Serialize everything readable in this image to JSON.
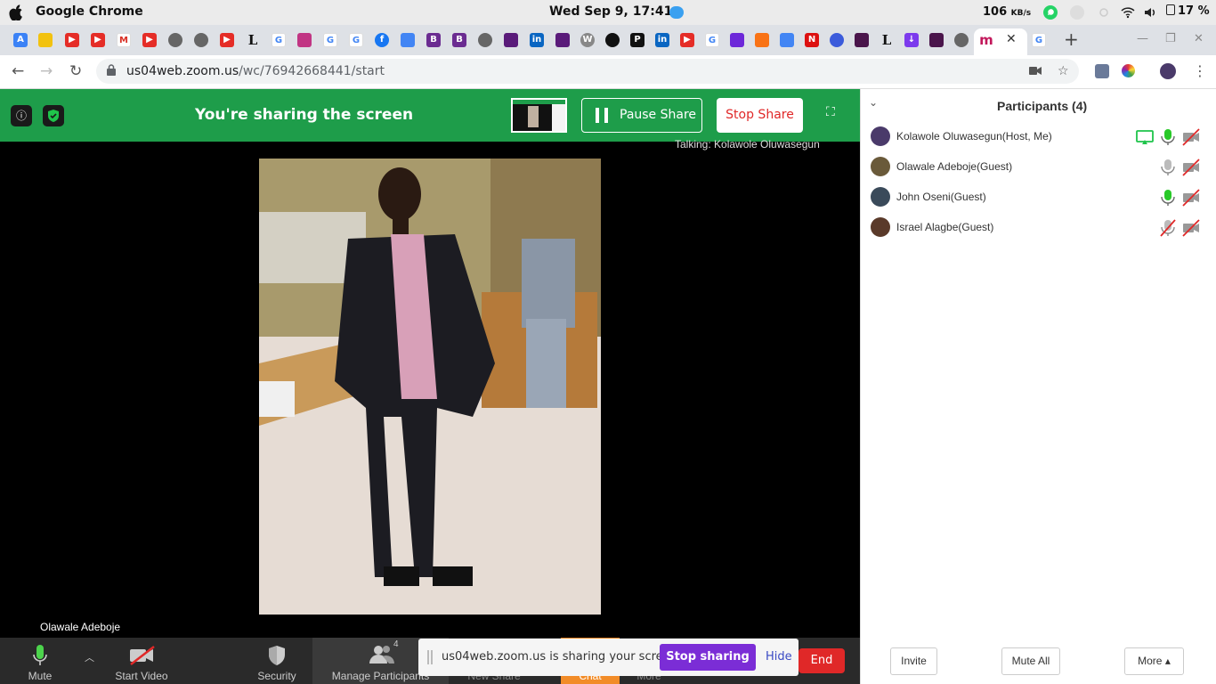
{
  "os": {
    "app_name": "Google Chrome",
    "clock": "Wed Sep  9, 17:41",
    "net_value": "106",
    "net_unit": "KB/s",
    "battery": "17 %"
  },
  "browser": {
    "url_host": "us04web.zoom.us",
    "url_path": "/wc/76942668441/start",
    "tab_count_letters": [
      "L",
      "L"
    ]
  },
  "share_bar": {
    "title": "You're sharing the screen",
    "pause_label": "Pause Share",
    "stop_label": "Stop Share",
    "talking": "Talking: Kolawole Oluwasegun"
  },
  "video": {
    "name_label": "Olawale Adeboje"
  },
  "toolbar": {
    "mute": "Mute",
    "start_video": "Start Video",
    "security": "Security",
    "manage_participants": "Manage Participants",
    "participants_count": "4",
    "new_share": "New Share",
    "chat": "Chat",
    "more": "More",
    "end": "End"
  },
  "notification": {
    "text": "us04web.zoom.us is sharing your screen.",
    "stop_sharing": "Stop sharing",
    "hide": "Hide"
  },
  "participants": {
    "title": "Participants (4)",
    "list": [
      {
        "name": "Kolawole Oluwasegun(Host, Me)",
        "mic": "active",
        "sharing": true
      },
      {
        "name": "Olawale Adeboje(Guest)",
        "mic": "on",
        "sharing": false
      },
      {
        "name": "John Oseni(Guest)",
        "mic": "active",
        "sharing": false
      },
      {
        "name": "Israel Alagbe(Guest)",
        "mic": "muted",
        "sharing": false
      }
    ],
    "invite": "Invite",
    "mute_all": "Mute All",
    "more": "More ▴"
  },
  "colors": {
    "share_green": "#1e9d4a",
    "stop_red": "#e02828",
    "stop_sharing_purple": "#7b2dd6",
    "mic_green": "#28c928"
  }
}
